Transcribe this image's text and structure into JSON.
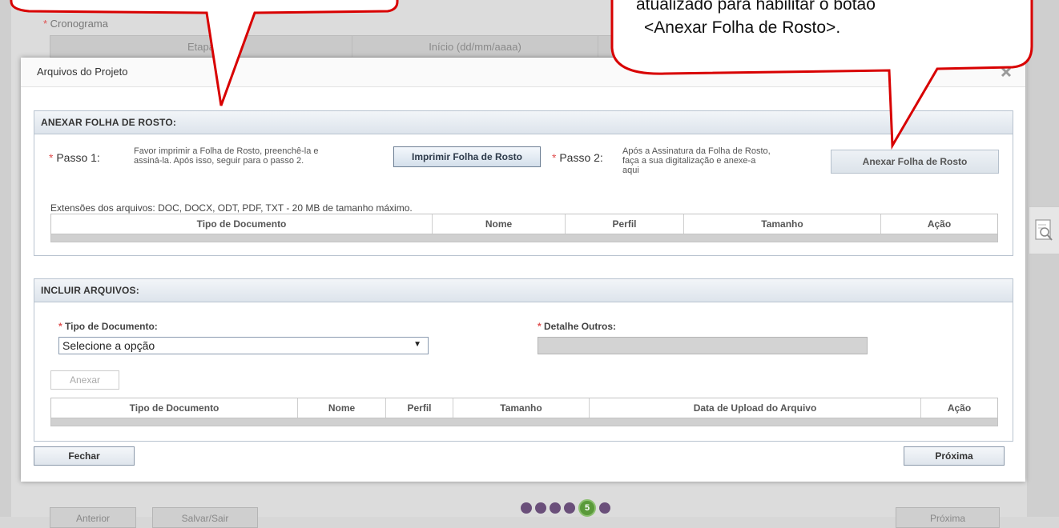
{
  "background": {
    "cronograma_label": "Cronograma",
    "columns": [
      "Etapa",
      "Início (dd/mm/aaaa)",
      ""
    ],
    "bottom": {
      "anterior": "Anterior",
      "salvar_sair": "Salvar/Sair",
      "proxima": "Próxima",
      "current_step": "5"
    }
  },
  "callout_right": {
    "text_line1": "atualizado para habilitar o botão",
    "text_line2": "<Anexar Folha de Rosto>."
  },
  "modal": {
    "title": "Arquivos do Projeto",
    "section1": {
      "title": "ANEXAR FOLHA DE ROSTO:",
      "step1_label": "Passo 1:",
      "step1_text_l1": "Favor imprimir a Folha de Rosto, preenchê-la e",
      "step1_text_l2": "assiná-la. Após isso, seguir para o passo 2.",
      "print_button": "Imprimir Folha de Rosto",
      "step2_label": "Passo 2:",
      "step2_text_l1": "Após a Assinatura da Folha de Rosto,",
      "step2_text_l2": "faça a sua digitalização e anexe-a",
      "step2_text_l3": "aqui",
      "attach_button": "Anexar Folha de Rosto",
      "extensions_info": "Extensões dos arquivos: DOC, DOCX, ODT, PDF, TXT - 20 MB de tamanho máximo.",
      "table_headers": [
        "Tipo de Documento",
        "Nome",
        "Perfil",
        "Tamanho",
        "Ação"
      ]
    },
    "section2": {
      "title": "INCLUIR ARQUIVOS:",
      "tipo_label": "Tipo de Documento:",
      "tipo_value": "Selecione a opção",
      "detalhe_label": "Detalhe Outros:",
      "anexar_button": "Anexar",
      "table_headers": [
        "Tipo de Documento",
        "Nome",
        "Perfil",
        "Tamanho",
        "Data de Upload do Arquivo",
        "Ação"
      ]
    },
    "fechar_button": "Fechar",
    "proxima_button": "Próxima"
  }
}
